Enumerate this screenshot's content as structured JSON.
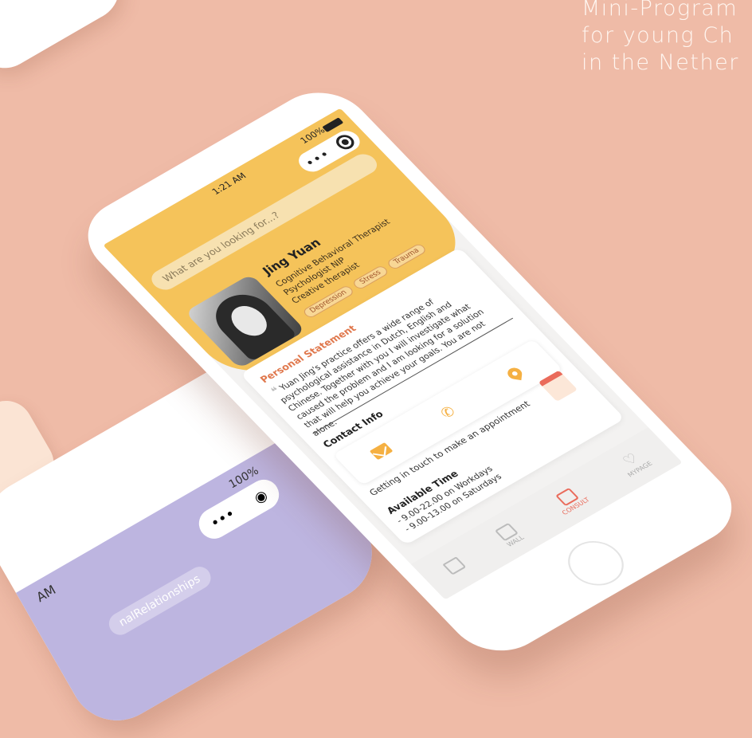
{
  "headline": {
    "line1": "Mini-Program",
    "line2": "for young Ch",
    "line3": "in the Nether"
  },
  "phone": {
    "status": {
      "time": "1:21 AM",
      "battery": "100%"
    },
    "search": {
      "placeholder": "What are you looking for...?"
    },
    "profile": {
      "name": "Jing Yuan",
      "roles": [
        "Cognitive Behavioral Therapist",
        "Psychologist NIP",
        "Creative therapist"
      ],
      "tags": [
        "Depression",
        "Stress",
        "Trauma"
      ]
    },
    "personal_statement": {
      "title": "Personal Statement",
      "text": "Yuan Jing's practice offers a wide range of psychological assistance in Dutch, English and Chinese. Together with you I will investigate what caused the problem and I am looking for a solution that will help you achieve your goals. You are not alone."
    },
    "contact": {
      "title": "Contact Info",
      "icons": [
        "mail-icon",
        "phone-icon",
        "location-pin-icon"
      ],
      "cta": "Getting in touch to make an appointment"
    },
    "availability": {
      "title": "Available Time",
      "lines": [
        "- 9.00-22.00 on Workdays",
        "- 9.00-13.00 on Saturdays"
      ]
    },
    "tabs": [
      {
        "label": "",
        "icon": "home-icon"
      },
      {
        "label": "WALL",
        "icon": "chat-icon"
      },
      {
        "label": "CONSULT",
        "icon": "document-icon"
      },
      {
        "label": "MYPAGE",
        "icon": "heart-icon"
      }
    ],
    "accent_color": "#f5c35a",
    "active_tab_color": "#ea6b5b"
  },
  "second_phone": {
    "time": "AM",
    "battery": "100%",
    "chip": "nalRelationships",
    "accent_color": "#bdb5e0"
  }
}
